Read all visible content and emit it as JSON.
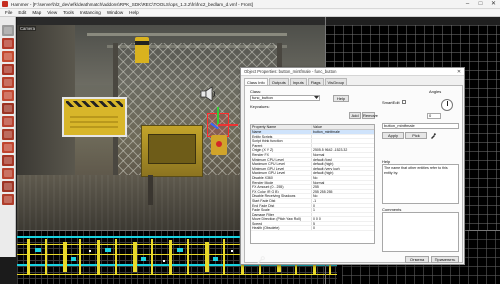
{
  "window": {
    "title": "Hammer - [F:\\server\\hl2_dev\\efk\\deathmatch\\addons\\RPK_SDK\\REC\\TOOLS\\ops_1.3.2\\fn\\fnc2_bedlam_d.vmf - Front]",
    "controls": [
      "–",
      "□",
      "✕"
    ]
  },
  "menu": [
    "File",
    "Edit",
    "Map",
    "View",
    "Tools",
    "Instancing",
    "Window",
    "Help"
  ],
  "viewport": {
    "label": "Camera"
  },
  "dialog": {
    "title": "Object Properties: button_mintfmale - func_button",
    "tabs": [
      "Class Info",
      "Outputs",
      "Inputs",
      "Flags",
      "VisGroup"
    ],
    "class_label": "Class:",
    "class_value": "func_button",
    "keyvalues_label": "Keyvalues:",
    "help_btn": "Help",
    "smart_edit_btn": "SmartEdit",
    "angles_label": "Angles",
    "angles_value": "0",
    "add_btn": "Add",
    "remove_btn": "Remove",
    "name_field_value": "button_mintfmale",
    "apply_btn": "Apply",
    "pick_btn": "Pick",
    "help_label": "Help",
    "help_text": "The name that other entities refer to this entity by.",
    "comments_label": "Comments",
    "table": {
      "col_name": "Property Name",
      "col_value": "Value",
      "rows": [
        {
          "name": "Name",
          "value": "button_mintfmale"
        },
        {
          "name": "Entity Scripts",
          "value": ""
        },
        {
          "name": "Script think function",
          "value": ""
        },
        {
          "name": "Parent",
          "value": ""
        },
        {
          "name": "Origin (X Y Z)",
          "value": "2505.5 9642 -1523.32"
        },
        {
          "name": "Render FX",
          "value": "Normal"
        },
        {
          "name": "Minimum CPU Level",
          "value": "default (low)"
        },
        {
          "name": "Maximum CPU Level",
          "value": "default (high)"
        },
        {
          "name": "Minimum GPU Level",
          "value": "default (very low)"
        },
        {
          "name": "Maximum GPU Level",
          "value": "default (high)"
        },
        {
          "name": "Disable X360",
          "value": "No"
        },
        {
          "name": "Render Mode",
          "value": "Normal"
        },
        {
          "name": "FX Amount (0 - 255)",
          "value": "255"
        },
        {
          "name": "FX Color (R G B)",
          "value": "255 255 255"
        },
        {
          "name": "Disable Receiving Shadows",
          "value": "No"
        },
        {
          "name": "Start Fade Dist",
          "value": "-1"
        },
        {
          "name": "End Fade Dist",
          "value": "0"
        },
        {
          "name": "Fade Scale",
          "value": "1"
        },
        {
          "name": "Damage Filter",
          "value": ""
        },
        {
          "name": "Move Direction (Pitch Yaw Roll)",
          "value": "0 0 0"
        },
        {
          "name": "Speed",
          "value": "5"
        },
        {
          "name": "Health (Obsolete)",
          "value": "0"
        }
      ]
    },
    "cancel_btn": "Отмена",
    "apply_bottom_btn": "Применить"
  },
  "colors": {
    "accent_selection": "#ff2c2c",
    "map_yellow": "#e8d82a",
    "map_cyan": "#19d2e0"
  }
}
